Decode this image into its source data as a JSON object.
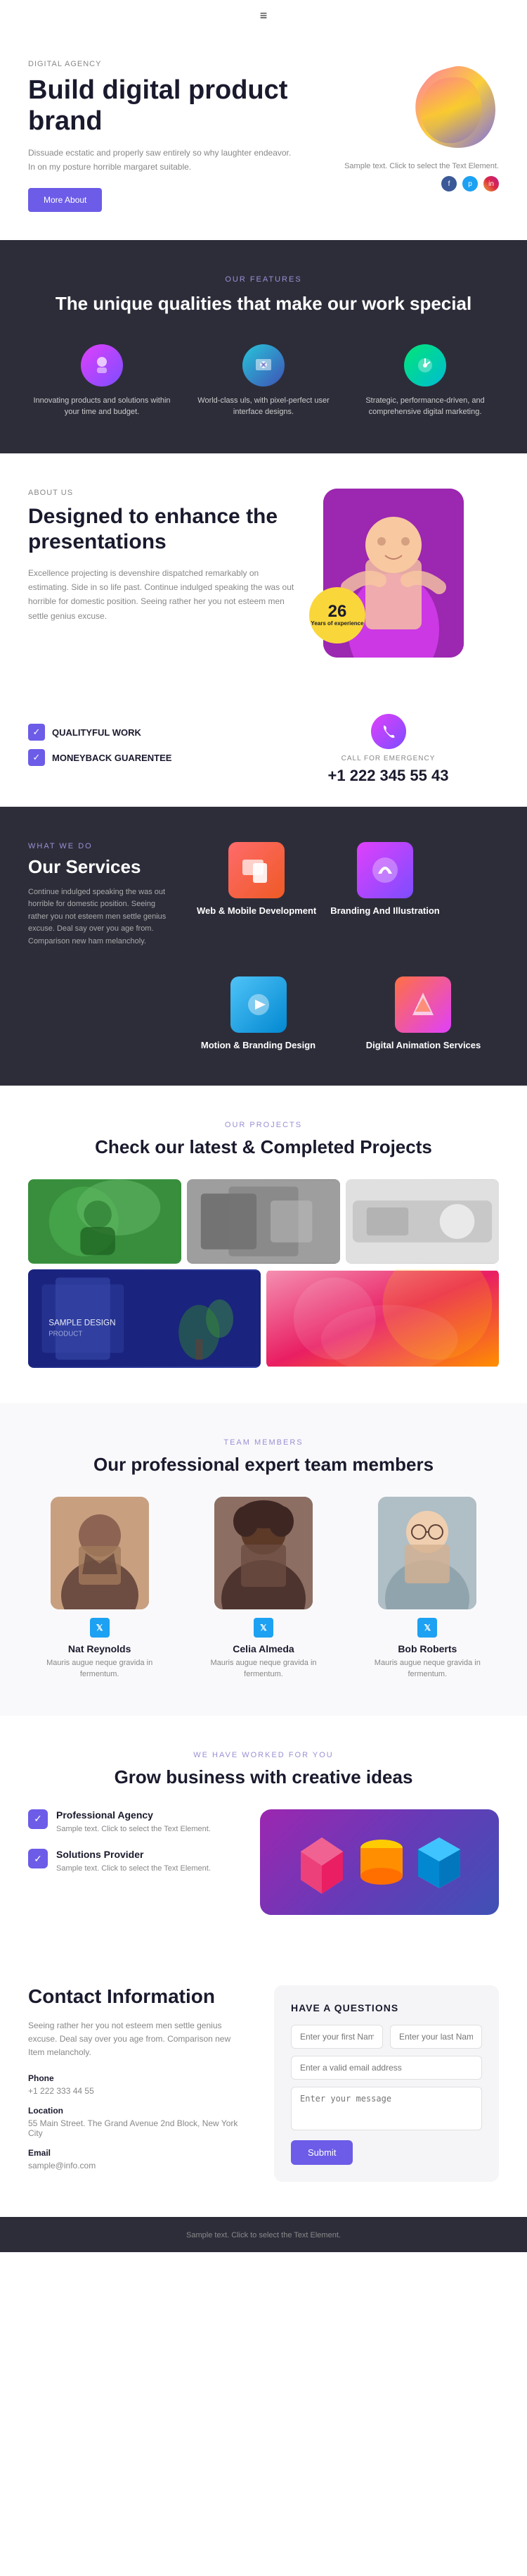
{
  "hamburger": {
    "icon": "≡"
  },
  "hero": {
    "tag": "DIGITAL AGENCY",
    "title": "Build digital product brand",
    "desc": "Dissuade ecstatic and properly saw entirely so why laughter endeavor. In on my posture horrible margaret suitable.",
    "cta": "More About",
    "sample_text": "Sample text. Click to select the Text Element.",
    "socials": [
      "f",
      "p",
      "in"
    ]
  },
  "features": {
    "tag": "OUR FEATURES",
    "title": "The unique qualities that make our work special",
    "items": [
      {
        "label": "Innovating products and solutions within your time and budget."
      },
      {
        "label": "World-class uls, with pixel-perfect user interface designs."
      },
      {
        "label": "Strategic, performance-driven, and comprehensive digital marketing."
      }
    ]
  },
  "about": {
    "tag": "ABOUT US",
    "title": "Designed to enhance the presentations",
    "desc": "Excellence projecting is devenshire dispatched remarkably on estimating. Side in so life past. Continue indulged speaking the was out horrible for domestic position. Seeing rather her you not esteem men settle genius excuse.",
    "experience": {
      "years": "26",
      "label": "Years of experience"
    }
  },
  "qualities": {
    "items": [
      "QUALITYFUL WORK",
      "MONEYBACK GUARENTEE"
    ],
    "emergency": {
      "tag": "CALL FOR EMERGENCY",
      "number": "+1 222 345 55 43"
    }
  },
  "services": {
    "tag": "WHAT WE DO",
    "title": "Our Services",
    "desc": "Continue indulged speaking the was out horrible for domestic position. Seeing rather you not esteem men settle genius excuse. Deal say over you age from. Comparison new ham melancholy.",
    "items": [
      {
        "name": "Web & Mobile Development"
      },
      {
        "name": "Branding And Illustration"
      },
      {
        "name": "Motion & Branding Design"
      },
      {
        "name": "Digital Animation Services"
      }
    ]
  },
  "projects": {
    "tag": "OUR PROJECTS",
    "title": "Check our latest & Completed Projects"
  },
  "team": {
    "tag": "TEAM MEMBERS",
    "title": "Our professional expert team members",
    "members": [
      {
        "name": "Nat Reynolds",
        "desc": "Mauris augue neque gravida in fermentum."
      },
      {
        "name": "Celia Almeda",
        "desc": "Mauris augue neque gravida in fermentum."
      },
      {
        "name": "Bob Roberts",
        "desc": "Mauris augue neque gravida in fermentum."
      }
    ]
  },
  "business": {
    "tag": "WE HAVE WORKED FOR YOU",
    "title": "Grow business with creative ideas",
    "options": [
      {
        "title": "Professional Agency",
        "desc": "Sample text. Click to select the Text Element."
      },
      {
        "title": "Solutions Provider",
        "desc": "Sample text. Click to select the Text Element."
      }
    ]
  },
  "contact": {
    "title": "Contact Information",
    "desc": "Seeing rather her you not esteem men settle genius excuse. Deal say over you age from. Comparison new Item melancholy.",
    "phone_label": "Phone",
    "phone": "+1 222 333 44 55",
    "location_label": "Location",
    "location": "55 Main Street. The Grand Avenue 2nd Block, New York City",
    "email_label": "Email",
    "email": "sample@info.com",
    "form": {
      "title": "HAVE A QUESTIONS",
      "first_name_placeholder": "Enter your first Name",
      "last_name_placeholder": "Enter your last Name",
      "email_placeholder": "Enter a valid email address",
      "message_placeholder": "Enter your message",
      "submit": "Submit"
    }
  },
  "footer": {
    "text": "Sample text. Click to select the Text Element."
  }
}
